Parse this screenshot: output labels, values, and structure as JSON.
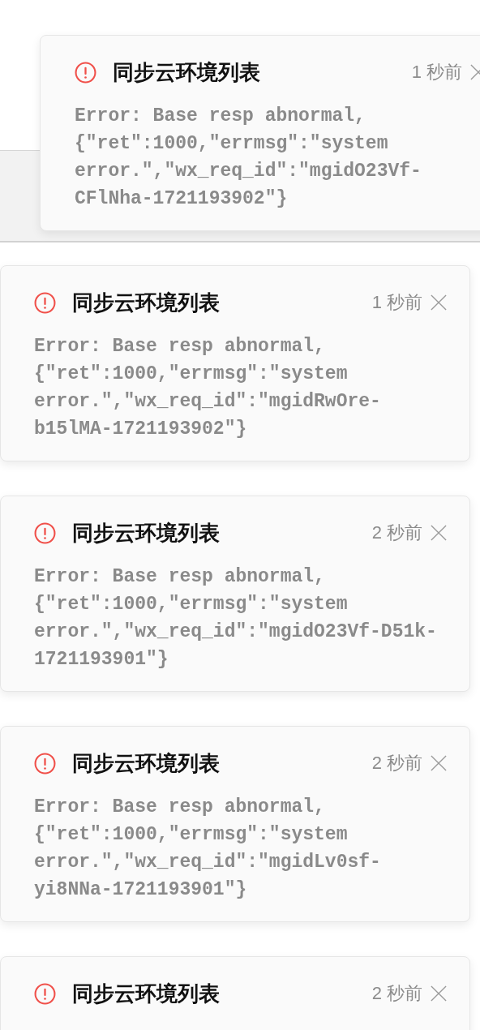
{
  "notifications": [
    {
      "kind": "error",
      "title": "同步云环境列表",
      "time": "1 秒前",
      "message_lines": [
        "Error: Base resp abnormal,",
        "{\"ret\":1000,\"errmsg\":\"system",
        "error.\",\"wx_req_id\":\"mgidO23Vf-",
        "CFlNha-1721193902\"}"
      ]
    },
    {
      "kind": "error",
      "title": "同步云环境列表",
      "time": "1 秒前",
      "message_lines": [
        "Error: Base resp abnormal,",
        "{\"ret\":1000,\"errmsg\":\"system",
        "error.\",\"wx_req_id\":\"mgidRwOre-",
        "b15lMA-1721193902\"}"
      ]
    },
    {
      "kind": "error",
      "title": "同步云环境列表",
      "time": "2 秒前",
      "message_lines": [
        "Error: Base resp abnormal,",
        "{\"ret\":1000,\"errmsg\":\"system",
        "error.\",\"wx_req_id\":\"mgidO23Vf-D51k-",
        "1721193901\"}"
      ]
    },
    {
      "kind": "error",
      "title": "同步云环境列表",
      "time": "2 秒前",
      "message_lines": [
        "Error: Base resp abnormal,",
        "{\"ret\":1000,\"errmsg\":\"system",
        "error.\",\"wx_req_id\":\"mgidLv0sf-",
        "yi8NNa-1721193901\"}"
      ]
    },
    {
      "kind": "error",
      "title": "同步云环境列表",
      "time": "2 秒前"
    }
  ]
}
